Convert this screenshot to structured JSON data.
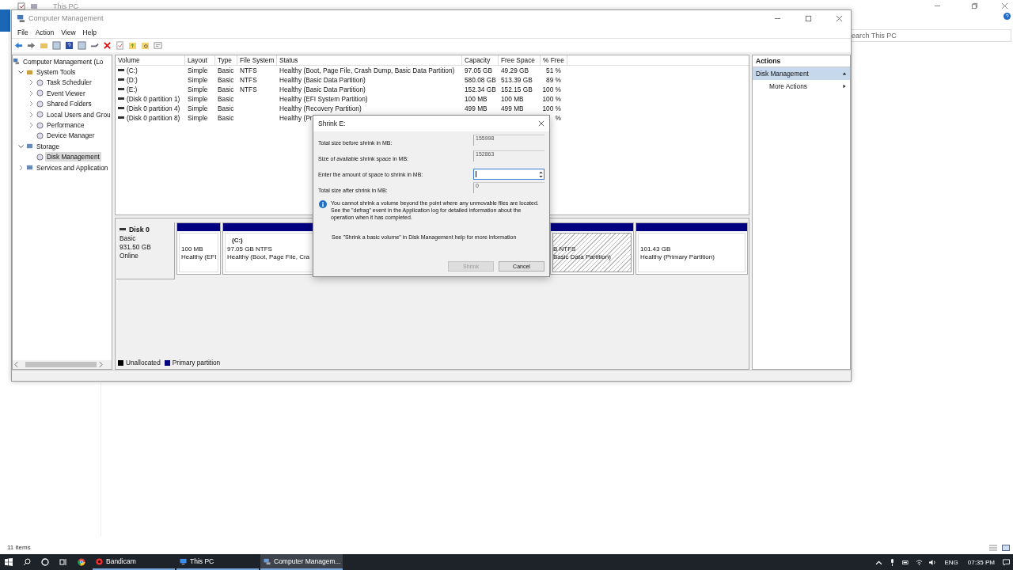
{
  "background_window": {
    "title": "This PC",
    "search_placeholder": "earch This PC",
    "status": "11 items"
  },
  "window": {
    "title": "Computer Management"
  },
  "menu": [
    "File",
    "Action",
    "View",
    "Help"
  ],
  "tree": {
    "label": "Computer Management (Lo",
    "children": [
      {
        "label": "System Tools",
        "expanded": true,
        "children": [
          {
            "label": "Task Scheduler",
            "expanded": false,
            "selected": false
          },
          {
            "label": "Event Viewer",
            "expanded": false,
            "selected": false
          },
          {
            "label": "Shared Folders",
            "expanded": false,
            "selected": false
          },
          {
            "label": "Local Users and Grou",
            "expanded": false,
            "selected": false
          },
          {
            "label": "Performance",
            "expanded": false,
            "selected": false
          },
          {
            "label": "Device Manager",
            "selected": false
          }
        ]
      },
      {
        "label": "Storage",
        "expanded": true,
        "children": [
          {
            "label": "Disk Management",
            "selected": true
          }
        ]
      },
      {
        "label": "Services and Application",
        "expanded": false
      }
    ]
  },
  "volumes": {
    "columns": [
      "Volume",
      "Layout",
      "Type",
      "File System",
      "Status",
      "Capacity",
      "Free Space",
      "% Free"
    ],
    "rows": [
      [
        "(C:)",
        "Simple",
        "Basic",
        "NTFS",
        "Healthy (Boot, Page File, Crash Dump, Basic Data Partition)",
        "97.05 GB",
        "49.29 GB",
        "51 %"
      ],
      [
        "(D:)",
        "Simple",
        "Basic",
        "NTFS",
        "Healthy (Basic Data Partition)",
        "580.08 GB",
        "513.39 GB",
        "89 %"
      ],
      [
        "(E:)",
        "Simple",
        "Basic",
        "NTFS",
        "Healthy (Basic Data Partition)",
        "152.34 GB",
        "152.15 GB",
        "100 %"
      ],
      [
        "(Disk 0 partition 1)",
        "Simple",
        "Basic",
        "",
        "Healthy (EFI System Partition)",
        "100 MB",
        "100 MB",
        "100 %"
      ],
      [
        "(Disk 0 partition 4)",
        "Simple",
        "Basic",
        "",
        "Healthy (Recovery Partition)",
        "499 MB",
        "499 MB",
        "100 %"
      ],
      [
        "(Disk 0 partition 8)",
        "Simple",
        "Basic",
        "",
        "Healthy (Pr",
        "",
        "",
        "%"
      ]
    ]
  },
  "disk": {
    "name": "Disk 0",
    "type": "Basic",
    "size": "931.50 GB",
    "status": "Online",
    "partitions": [
      {
        "size": "100 MB",
        "status": "Healthy (EFI",
        "selected": false
      },
      {
        "title": "(C:)",
        "size": "97.05 GB NTFS",
        "status": "Healthy (Boot, Page File, Cra",
        "selected": false
      },
      {
        "size": "B NTFS",
        "status": "Basic Data Partition)",
        "selected": true
      },
      {
        "size": "101.43 GB",
        "status": "Healthy (Primary Partition)",
        "selected": false
      }
    ]
  },
  "legend": [
    {
      "label": "Unallocated",
      "color": "#000000"
    },
    {
      "label": "Primary partition",
      "color": "#000080"
    }
  ],
  "actions": {
    "title": "Actions",
    "section": "Disk Management",
    "expanded": true,
    "items": [
      "More Actions"
    ]
  },
  "dialog": {
    "title": "Shrink E:",
    "fields": [
      {
        "label": "Total size before shrink in MB:",
        "value": "155998",
        "kind": "readonly"
      },
      {
        "label": "Size of available shrink space in MB:",
        "value": "152863",
        "kind": "readonly"
      },
      {
        "label": "Enter the amount of space to shrink in MB:",
        "kind": "spin"
      },
      {
        "label": "Total size after shrink in MB:",
        "value": "0",
        "kind": "readonly"
      }
    ],
    "info": "You cannot shrink a volume beyond the point where any unmovable files are located. See the \"defrag\" event in the Application log for detailed information about the operation when it has completed.",
    "help": "See \"Shrink a basic volume\" in Disk Management help for more information",
    "buttons": [
      {
        "label": "Shrink",
        "disabled": true
      },
      {
        "label": "Cancel",
        "disabled": false
      }
    ]
  },
  "taskbar": {
    "apps": [
      {
        "label": "Bandicam",
        "selected": false
      },
      {
        "label": "This PC",
        "selected": false
      },
      {
        "label": "Computer Managem...",
        "selected": true
      }
    ],
    "language": "ENG",
    "time": "07:35 PM"
  }
}
